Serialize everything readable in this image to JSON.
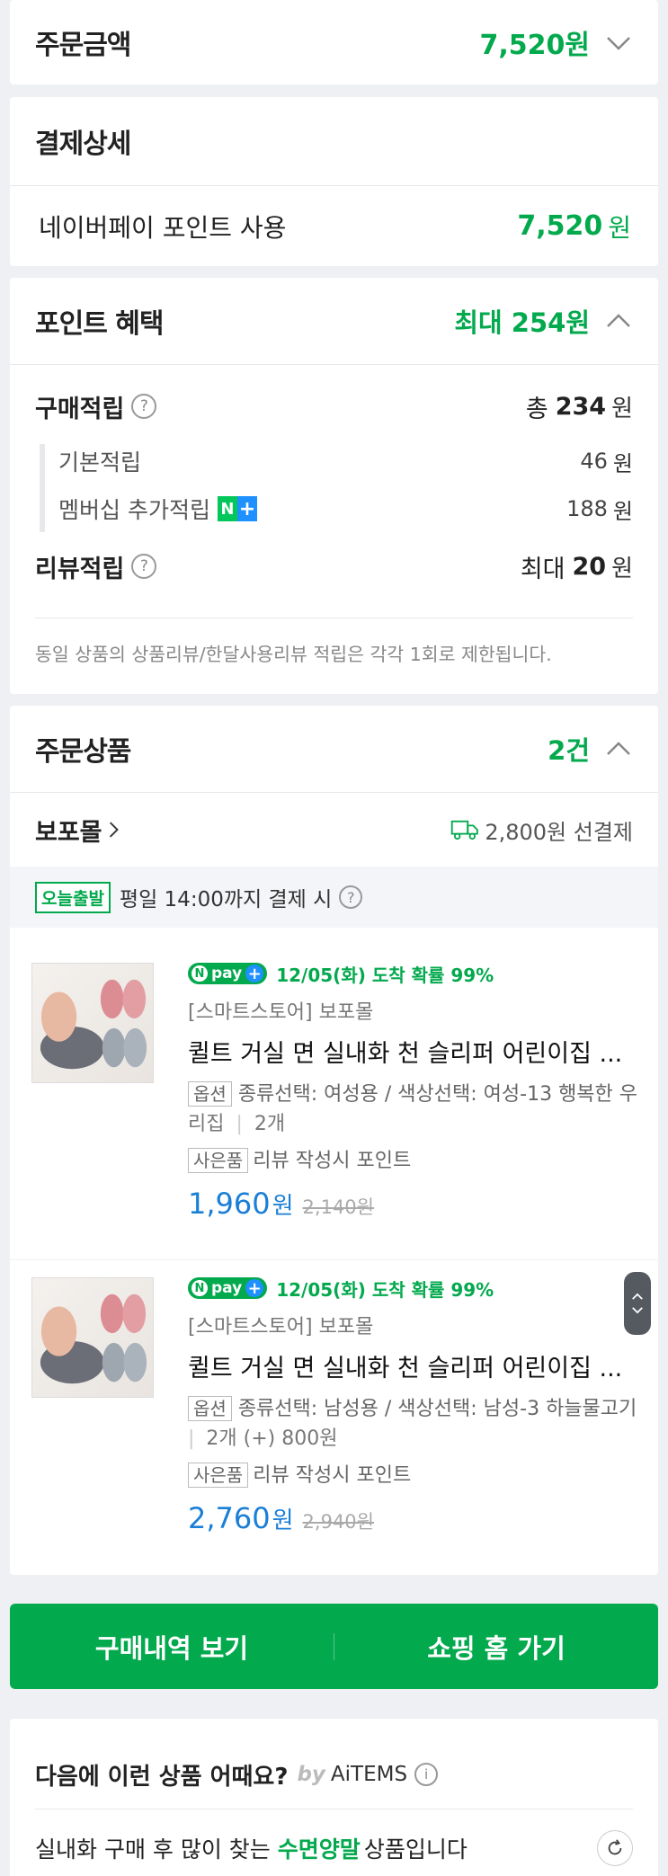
{
  "order_amount": {
    "label": "주문금액",
    "value": "7,520원"
  },
  "payment": {
    "title": "결제상세",
    "method_label": "네이버페이 포인트 사용",
    "method_value": "7,520",
    "unit": "원"
  },
  "points": {
    "title": "포인트 혜택",
    "max": "최대 254원",
    "purchase": {
      "label": "구매적립",
      "prefix": "총",
      "value": "234",
      "unit": "원"
    },
    "basic": {
      "label": "기본적립",
      "value": "46",
      "unit": "원"
    },
    "membership": {
      "label": "멤버십 추가적립",
      "value": "188",
      "unit": "원",
      "badge": "N+"
    },
    "review": {
      "label": "리뷰적립",
      "prefix": "최대",
      "value": "20",
      "unit": "원"
    },
    "notice": "동일 상품의 상품리뷰/한달사용리뷰 적립은 각각 1회로 제한됩니다."
  },
  "order_items": {
    "title": "주문상품",
    "count": "2건",
    "store": "보포몰",
    "shipping": "2,800원 선결제",
    "today_badge": "오늘출발",
    "today_text": "평일 14:00까지 결제 시",
    "items": [
      {
        "npay": "pay",
        "delivery": "12/05(화) 도착 확률 99%",
        "seller": "[스마트스토어] 보포몰",
        "name": "퀼트 거실 면 실내화 천 슬리퍼 어린이집 ...",
        "option_tag": "옵션",
        "option_line1": "종류선택: 여성용 / 색상선택: 여성-13 행복한 우",
        "option_line2": "리집",
        "option_qty": "2개",
        "gift_tag": "사은품",
        "gift_text": "리뷰 작성시 포인트",
        "price": "1,960",
        "price_unit": "원",
        "orig_price": "2,140원"
      },
      {
        "npay": "pay",
        "delivery": "12/05(화) 도착 확률 99%",
        "seller": "[스마트스토어] 보포몰",
        "name": "퀼트 거실 면 실내화 천 슬리퍼 어린이집 ...",
        "option_tag": "옵션",
        "option_line1": "종류선택: 남성용 / 색상선택: 남성-3 하늘물고기",
        "option_line2": "2개 (+) 800원",
        "gift_tag": "사은품",
        "gift_text": "리뷰 작성시 포인트",
        "price": "2,760",
        "price_unit": "원",
        "orig_price": "2,940원"
      }
    ]
  },
  "actions": {
    "history": "구매내역 보기",
    "home": "쇼핑 홈 가기"
  },
  "recommend": {
    "title": "다음에 이런 상품 어때요?",
    "by": "by",
    "brand": "AiTEMS",
    "sub_prefix": "실내화 구매 후 많이 찾는",
    "sub_highlight": "수면양말",
    "sub_suffix": "상품입니다"
  },
  "colors": {
    "accent": "#03a94d",
    "price": "#1a7fd6"
  }
}
